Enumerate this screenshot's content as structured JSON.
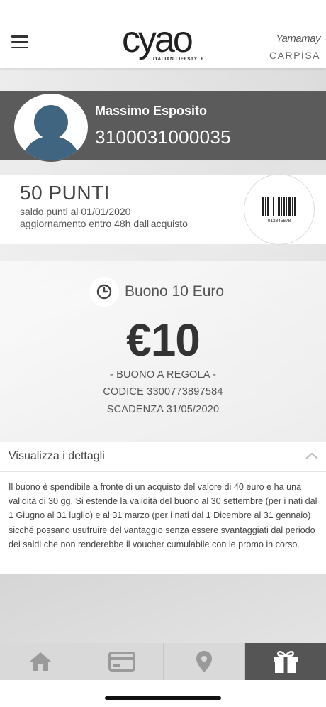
{
  "header": {
    "logo": "cyao",
    "logo_sub": "ITALIAN LIFESTYLE",
    "brand_primary": "Yamamay",
    "brand_secondary": "CARPISA"
  },
  "profile": {
    "name": "Massimo Esposito",
    "card_number": "3100031000035"
  },
  "points": {
    "title": "50 PUNTI",
    "balance_date": "saldo punti al 01/01/2020",
    "update_note": "aggiornamento entro 48h dall'acquisto",
    "barcode_caption": "012345678"
  },
  "voucher": {
    "title": "Buono 10 Euro",
    "amount": "€10",
    "status": "- BUONO A REGOLA -",
    "code": "CODICE 3300773897584",
    "expiry": "SCADENZA 31/05/2020"
  },
  "details": {
    "toggle_label": "Visualizza i dettagli",
    "text": "Il buono è spendibile a fronte di un acquisto del valore di 40 euro e ha una validità di 30 gg. Si estende la validità del buono al 30 settembre (per i nati dal 1 Giugno al 31 luglio) e al 31 marzo (per i nati dal 1 Dicembre al 31 gennaio) sicché possano usufruire del vantaggio senza essere svantaggiati dal periodo dei saldi che non renderebbe il voucher cumulabile con le promo in corso."
  },
  "bottom_nav": {
    "items": [
      {
        "icon": "home-icon",
        "active": false
      },
      {
        "icon": "card-icon",
        "active": false
      },
      {
        "icon": "location-pin-icon",
        "active": false
      },
      {
        "icon": "gift-icon",
        "active": true
      }
    ]
  },
  "colors": {
    "profile_bar": "#5b5b5b",
    "active_nav": "#555555",
    "nav_background": "#d9d9d9",
    "avatar_fill": "#3f6580"
  }
}
